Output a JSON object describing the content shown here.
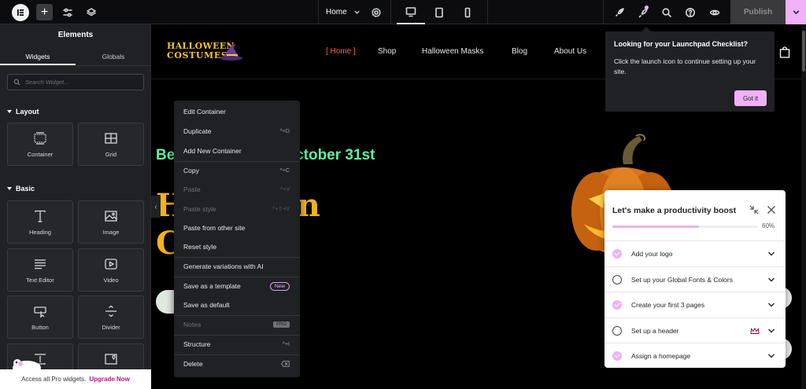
{
  "topbar": {
    "page_name": "Home",
    "publish_label": "Publish",
    "icons": [
      "elementor-logo-icon",
      "plus-icon",
      "sliders-icon",
      "layers-icon",
      "chevron-down-icon",
      "gear-icon",
      "desktop-icon",
      "tablet-icon",
      "mobile-icon",
      "rocket-icon",
      "launchpad-icon",
      "search-icon",
      "help-icon",
      "eye-icon"
    ]
  },
  "sidebar": {
    "title": "Elements",
    "tabs": [
      "Widgets",
      "Globals"
    ],
    "search_placeholder": "Search Widget...",
    "sections": [
      {
        "title": "Layout",
        "widgets": [
          {
            "label": "Container",
            "icon": "container-icon"
          },
          {
            "label": "Grid",
            "icon": "grid-icon"
          }
        ]
      },
      {
        "title": "Basic",
        "widgets": [
          {
            "label": "Heading",
            "icon": "heading-icon"
          },
          {
            "label": "Image",
            "icon": "image-icon"
          },
          {
            "label": "Text Editor",
            "icon": "text-editor-icon"
          },
          {
            "label": "Video",
            "icon": "video-icon"
          },
          {
            "label": "Button",
            "icon": "button-icon"
          },
          {
            "label": "Divider",
            "icon": "divider-icon"
          }
        ]
      }
    ],
    "pro_banner": {
      "text": "Access all Pro widgets.",
      "link": "Upgrade Now"
    }
  },
  "site": {
    "logo_line1": "HALLOWEEN",
    "logo_line2": "COSTUMES",
    "nav": [
      "[ Home ]",
      "Shop",
      "Halloween Masks",
      "Blog",
      "About Us"
    ],
    "hero_date": "October 31st",
    "hero_date_prefix": "Be",
    "hero_title_line1": "H",
    "hero_title_line2": "C",
    "hero_title_tail": "n"
  },
  "context_menu": {
    "items": [
      {
        "label": "Edit Container",
        "shortcut": "",
        "disabled": false
      },
      {
        "label": "Duplicate",
        "shortcut": "^+D",
        "disabled": false
      },
      {
        "label": "Add New Container",
        "shortcut": "",
        "disabled": false
      },
      {
        "label": "Copy",
        "shortcut": "^+C",
        "disabled": false
      },
      {
        "label": "Paste",
        "shortcut": "^+V",
        "disabled": true
      },
      {
        "label": "Paste style",
        "shortcut": "^+⇧+V",
        "disabled": true
      },
      {
        "label": "Paste from other site",
        "shortcut": "",
        "disabled": false
      },
      {
        "label": "Reset style",
        "shortcut": "",
        "disabled": false
      },
      {
        "label": "Generate variations with AI",
        "shortcut": "",
        "disabled": false
      },
      {
        "label": "Save as a template",
        "shortcut": "",
        "badge": "New",
        "disabled": false
      },
      {
        "label": "Save as default",
        "shortcut": "",
        "disabled": false
      },
      {
        "label": "Notes",
        "shortcut": "",
        "badge": "PRO",
        "disabled": true
      },
      {
        "label": "Structure",
        "shortcut": "^+I",
        "disabled": false
      },
      {
        "label": "Delete",
        "shortcut": "",
        "disabled": false
      }
    ]
  },
  "launchpad_tip": {
    "title": "Looking for your Launchpad Checklist?",
    "body": "Click the launch icon to continue setting up your site.",
    "button": "Got it"
  },
  "checklist": {
    "title": "Let's make a productivity boost",
    "progress": 60,
    "progress_label": "60%",
    "items": [
      {
        "label": "Add your logo",
        "done": true,
        "pro": false
      },
      {
        "label": "Set up your Global Fonts & Colors",
        "done": false,
        "pro": false
      },
      {
        "label": "Create your first 3 pages",
        "done": true,
        "pro": false
      },
      {
        "label": "Set up a header",
        "done": false,
        "pro": true
      },
      {
        "label": "Assign a homepage",
        "done": true,
        "pro": false
      }
    ]
  },
  "colors": {
    "accent_pink": "#f0b1f6",
    "nav_active": "#ff6a2a",
    "hero_green": "#5ef2a5",
    "hero_yellow": "#f5b21a",
    "panel_dark": "#1f2124"
  }
}
